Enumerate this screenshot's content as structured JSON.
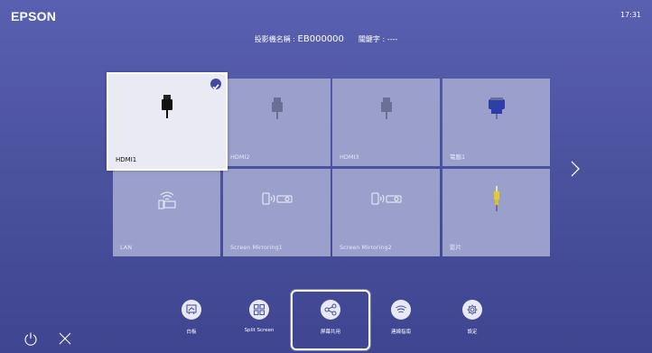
{
  "brand": "EPSON",
  "clock": "17:31",
  "projector": {
    "name_label": "投影機名稱 : ",
    "name_value": "EB000000",
    "keyword_label": "關鍵字 : ",
    "keyword_value": "----"
  },
  "sources": [
    {
      "label": "HDMI1",
      "icon": "hdmi-cable-icon",
      "selected": true
    },
    {
      "label": "HDMI2",
      "icon": "hdmi-cable-icon"
    },
    {
      "label": "HDMI3",
      "icon": "hdmi-cable-icon"
    },
    {
      "label": "電腦1",
      "icon": "vga-connector-icon"
    },
    {
      "label": "LAN",
      "icon": "wireless-network-icon"
    },
    {
      "label": "Screen Mirroring1",
      "icon": "screen-mirroring-icon"
    },
    {
      "label": "Screen Mirroring2",
      "icon": "screen-mirroring-icon"
    },
    {
      "label": "影片",
      "icon": "rca-video-plug-icon"
    }
  ],
  "dock": [
    {
      "label": "白板",
      "icon": "whiteboard-icon"
    },
    {
      "label": "Split Screen",
      "icon": "split-screen-icon"
    },
    {
      "label": "屏幕共用",
      "icon": "share-icon",
      "selected": true
    },
    {
      "label": "連線指南",
      "icon": "wifi-signal-icon"
    },
    {
      "label": "設定",
      "icon": "gear-icon"
    }
  ],
  "colors": {
    "background": "#4e55a3",
    "tile": "#9a9fcc",
    "tile_selected": "#e9eaf4",
    "vga_blue": "#2c3ea8",
    "rca_yellow": "#e2cd2e"
  }
}
